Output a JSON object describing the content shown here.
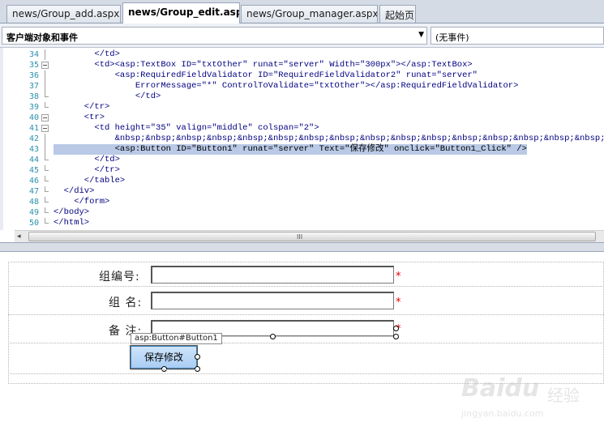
{
  "tabs": [
    {
      "label": "news/Group_add.aspx",
      "active": false
    },
    {
      "label": "news/Group_edit.aspx",
      "active": true
    },
    {
      "label": "news/Group_manager.aspx",
      "active": false
    },
    {
      "label": "起始页",
      "active": false
    }
  ],
  "dropdowns": {
    "objects": "客户端对象和事件",
    "events": "(无事件)"
  },
  "code_lines": [
    {
      "num": "34",
      "text": "        </td>"
    },
    {
      "num": "35",
      "text": "        <td><asp:TextBox ID=\"txtOther\" runat=\"server\" Width=\"300px\"></asp:TextBox>"
    },
    {
      "num": "36",
      "text": "            <asp:RequiredFieldValidator ID=\"RequiredFieldValidator2\" runat=\"server\""
    },
    {
      "num": "37",
      "text": "                ErrorMessage=\"*\" ControlToValidate=\"txtOther\"></asp:RequiredFieldValidator>"
    },
    {
      "num": "38",
      "text": "                </td>"
    },
    {
      "num": "39",
      "text": "      </tr>"
    },
    {
      "num": "40",
      "text": "      <tr>"
    },
    {
      "num": "41",
      "text": "        <td height=\"35\" valign=\"middle\" colspan=\"2\">"
    },
    {
      "num": "42",
      "text": "            &nbsp;&nbsp;&nbsp;&nbsp;&nbsp;&nbsp;&nbsp;&nbsp;&nbsp;&nbsp;&nbsp;&nbsp;&nbsp;&nbsp;&nbsp;&nbsp;&nbsp;&nbsp;&nbsp;&nb"
    },
    {
      "num": "43",
      "text": "            <asp:Button ID=\"Button1\" runat=\"server\" Text=\"保存修改\" onclick=\"Button1_Click\" />"
    },
    {
      "num": "44",
      "text": "        </td>"
    },
    {
      "num": "45",
      "text": "        </tr>"
    },
    {
      "num": "46",
      "text": "      </table>"
    },
    {
      "num": "47",
      "text": "  </div>"
    },
    {
      "num": "48",
      "text": "    </form>"
    },
    {
      "num": "49",
      "text": "</body>"
    },
    {
      "num": "50",
      "text": "</html>"
    }
  ],
  "scroll_grip": "III",
  "design": {
    "label_group_no": "组编号:",
    "label_group_name": "组 名:",
    "label_remark": "备 注:",
    "star": "*",
    "tooltip": "asp:Button#Button1",
    "button_label": "保存修改"
  },
  "watermark": {
    "brand": "Baidu",
    "cn": "经验",
    "url": "jingyan.baidu.com"
  }
}
